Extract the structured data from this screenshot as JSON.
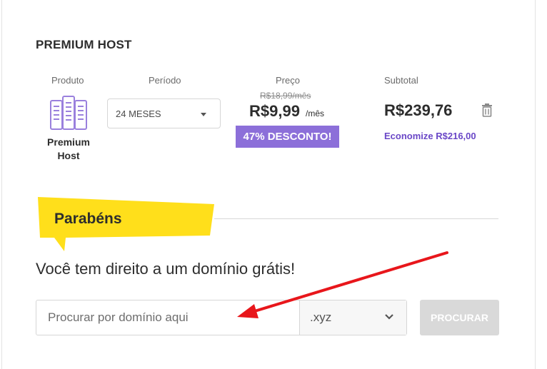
{
  "plan": {
    "title": "PREMIUM HOST",
    "product_label": "Produto",
    "period_label": "Período",
    "price_label": "Preço",
    "subtotal_label": "Subtotal",
    "product_name": "Premium Host",
    "period_value": "24 MESES",
    "old_price": "R$18,99/mês",
    "price": "R$9,99",
    "price_unit": "/mês",
    "discount": "47% DESCONTO!",
    "subtotal": "R$239,76",
    "savings": "Economize R$216,00",
    "icons": {
      "product": "server-icon",
      "delete": "trash-icon",
      "period": "caret-down-icon"
    }
  },
  "promo": {
    "tag": "Parabéns",
    "message": "Você tem direito a um domínio grátis!"
  },
  "domain_search": {
    "placeholder": "Procurar por domínio aqui",
    "tld": ".xyz",
    "button": "PROCURAR"
  },
  "colors": {
    "accent": "#8c6fd9",
    "savings": "#6a47c7",
    "tag": "#ffdf1b",
    "annotation_arrow": "#e8161b",
    "button_disabled": "#d9d9d9"
  }
}
